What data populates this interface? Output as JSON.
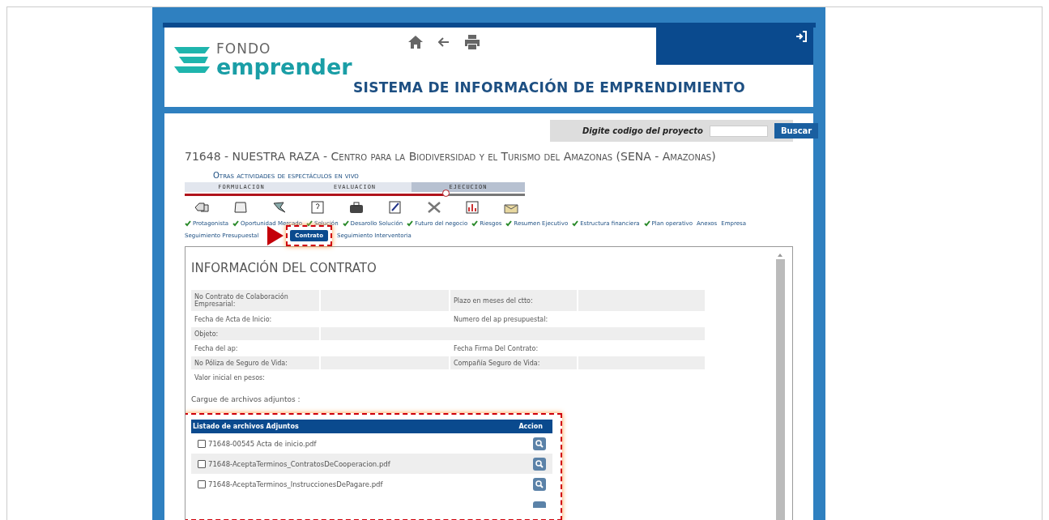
{
  "header": {
    "logo_top": "FONDO",
    "logo_bottom": "emprender",
    "system_title": "SISTEMA DE INFORMACIÓN DE EMPRENDIMIENTO"
  },
  "search": {
    "label": "Digite codigo del proyecto",
    "button": "Buscar"
  },
  "project": {
    "title": "71648 - NUESTRA RAZA - Centro para la Biodiversidad y el Turismo del Amazonas (SENA - Amazonas)",
    "activity": "Otras actividades de espectáculos en vivo"
  },
  "phases": [
    {
      "label": "FORMULACION",
      "selected": false
    },
    {
      "label": "EVALUACION",
      "selected": false
    },
    {
      "label": "EJECUCION",
      "selected": true
    }
  ],
  "progress": {
    "level": 0.77
  },
  "nav_links": [
    {
      "label": "Protagonista",
      "done": true,
      "selected": false
    },
    {
      "label": "Oportunidad Mercado",
      "done": true,
      "selected": false
    },
    {
      "label": "Solución",
      "done": true,
      "selected": false
    },
    {
      "label": "Desarollo Solución",
      "done": true,
      "selected": false
    },
    {
      "label": "Futuro del negocio",
      "done": true,
      "selected": false
    },
    {
      "label": "Riesgos",
      "done": true,
      "selected": false
    },
    {
      "label": "Resumen Ejecutivo",
      "done": true,
      "selected": false
    },
    {
      "label": "Estructura financiera",
      "done": true,
      "selected": false
    },
    {
      "label": "Plan operativo",
      "done": true,
      "selected": false
    },
    {
      "label": "Anexos",
      "done": false,
      "selected": false
    },
    {
      "label": "Empresa",
      "done": false,
      "selected": false
    },
    {
      "label": "Seguimiento Presupuestal",
      "done": false,
      "selected": false
    },
    {
      "label": "Contrato",
      "done": false,
      "selected": true
    },
    {
      "label": "Seguimiento Interventoria",
      "done": false,
      "selected": false
    }
  ],
  "contract": {
    "title": "INFORMACIÓN DEL CONTRATO",
    "rows": [
      {
        "fields": [
          "No Contrato de Colaboración Empresarial:",
          "Plazo en meses del ctto:"
        ]
      },
      {
        "fields": [
          "Fecha de Acta de Inicio:",
          "Numero del ap presupuestal:"
        ]
      },
      {
        "fields": [
          "Objeto:"
        ]
      },
      {
        "fields": [
          "Fecha del ap:",
          "Fecha Firma Del Contrato:"
        ]
      },
      {
        "fields": [
          "No Póliza de Seguro de Vida:",
          "Compañía Seguro de Vida:"
        ]
      },
      {
        "fields": [
          "Valor inicial en pesos:"
        ]
      }
    ]
  },
  "attachments": {
    "label": "Cargue de archivos adjuntos :",
    "columns": [
      "Listado de archivos Adjuntos",
      "Accion"
    ],
    "files": [
      {
        "name": "71648-00545 Acta de inicio.pdf",
        "checked": false
      },
      {
        "name": "71648-AceptaTerminos_ContratosDeCooperacion.pdf",
        "checked": false
      },
      {
        "name": "71648-AceptaTerminos_InstruccionesDePagare.pdf",
        "checked": false
      }
    ]
  }
}
